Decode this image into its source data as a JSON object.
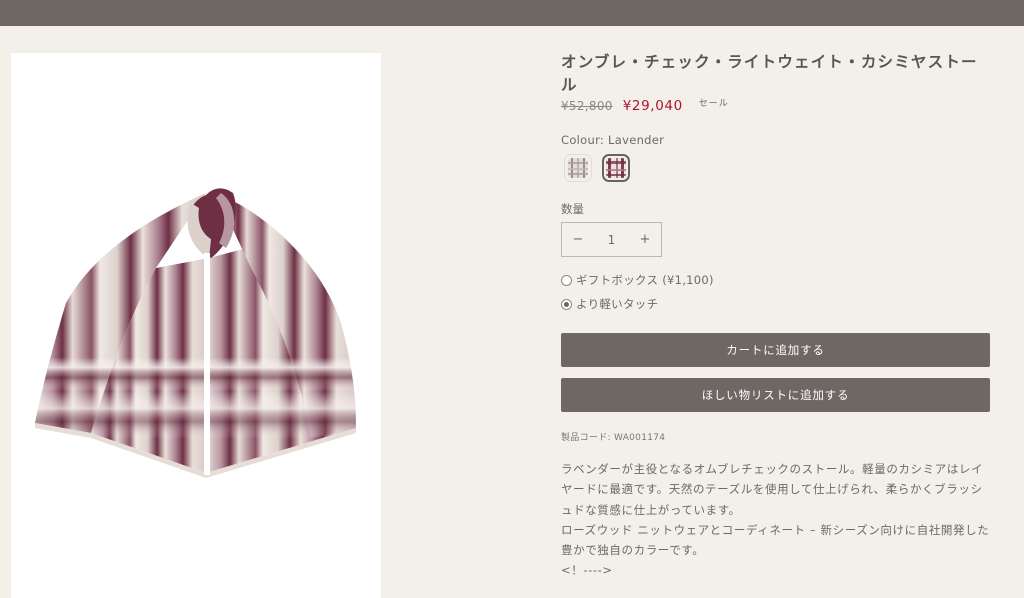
{
  "product": {
    "title": "オンブレ・チェック・ライトウェイト・カシミヤストール",
    "price_original": "¥52,800",
    "price_sale": "¥29,040",
    "sale_badge": "セール",
    "colour_label": "Colour: Lavender",
    "swatches": [
      "Light gray check",
      "Lavender"
    ],
    "quantity_label": "数量",
    "quantity_value": "1",
    "qty_minus": "−",
    "qty_plus": "+",
    "options": [
      {
        "label": "ギフトボックス (¥1,100)",
        "checked": false
      },
      {
        "label": "より軽いタッチ",
        "checked": true
      }
    ],
    "add_to_cart": "カートに追加する",
    "add_to_wishlist": "ほしい物リストに追加する",
    "product_code": "製品コード: WA001174",
    "description": [
      "ラベンダーが主役となるオムブレチェックのストール。軽量のカシミアはレイヤードに最適です。天然のテーズルを使用して仕上げられ、柔らかくブラッシュドな質感に仕上がっています。",
      "ローズウッド ニットウェアとコーディネート – 新シーズン向けに自社開発した豊かで独自のカラーです。",
      "<！---->"
    ]
  },
  "colors": {
    "topbar": "#6f6764",
    "background": "#f3f0ea",
    "sale_price": "#b0122b",
    "button": "#6f6764",
    "scarf_plum": "#6e2f44",
    "scarf_cream": "#ebe2db"
  },
  "icons": {
    "minus": "minus-icon",
    "plus": "plus-icon"
  }
}
